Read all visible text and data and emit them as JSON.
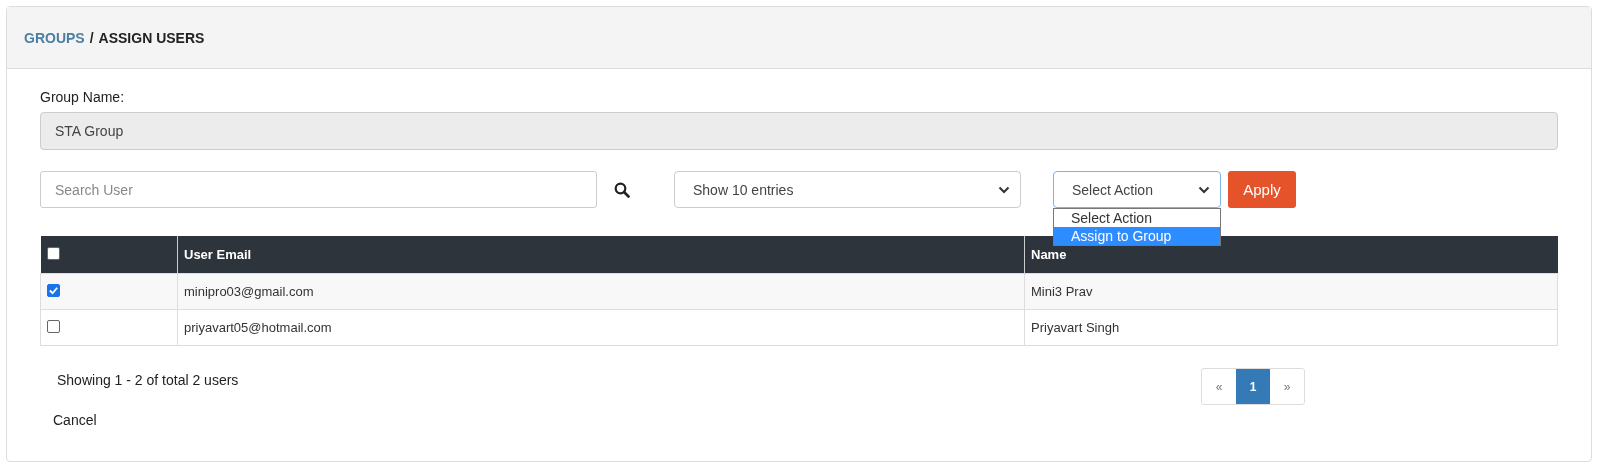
{
  "breadcrumb": {
    "parent": "GROUPS",
    "separator": "/",
    "current": "ASSIGN USERS"
  },
  "group_name": {
    "label": "Group Name:",
    "value": "STA Group",
    "disabled": true
  },
  "search": {
    "placeholder": "Search User"
  },
  "page_size": {
    "value": "Show 10 entries"
  },
  "action": {
    "value": "Select Action",
    "expanded": true,
    "options": [
      {
        "label": "Select Action",
        "highlighted": false
      },
      {
        "label": "Assign to Group",
        "highlighted": true
      }
    ]
  },
  "apply_button": "Apply",
  "table": {
    "select_all": {
      "checked": false
    },
    "columns": [
      "User Email",
      "Name"
    ],
    "rows": [
      {
        "checked": true,
        "email": "minipro03@gmail.com",
        "name": "Mini3 Prav"
      },
      {
        "checked": false,
        "email": "priyavart05@hotmail.com",
        "name": "Priyavart Singh"
      }
    ]
  },
  "summary": "Showing 1 - 2 of total 2 users",
  "pagination": {
    "prev": "«",
    "pages": [
      {
        "label": "1",
        "selected": true
      }
    ],
    "next": "»"
  },
  "cancel": "Cancel"
}
